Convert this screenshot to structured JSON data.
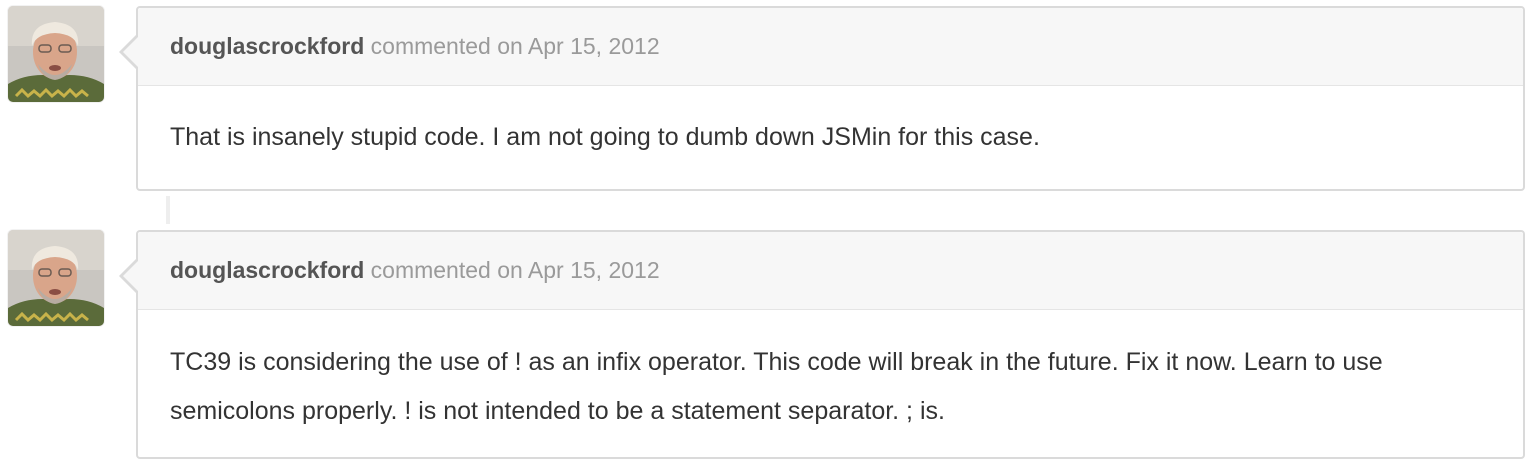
{
  "comments": [
    {
      "author": "douglascrockford",
      "action": "commented on",
      "date": "Apr 15, 2012",
      "body": "That is insanely stupid code. I am not going to dumb down JSMin for this case."
    },
    {
      "author": "douglascrockford",
      "action": "commented on",
      "date": "Apr 15, 2012",
      "body": "TC39 is considering the use of ! as an infix operator. This code will break in the future. Fix it now. Learn to use semicolons properly. ! is not intended to be a statement separator. ; is."
    }
  ],
  "colors": {
    "header_bg": "#f7f7f7",
    "border": "#dadada",
    "author_text": "#555555",
    "meta_text": "#9a9a9a",
    "body_text": "#333333"
  }
}
